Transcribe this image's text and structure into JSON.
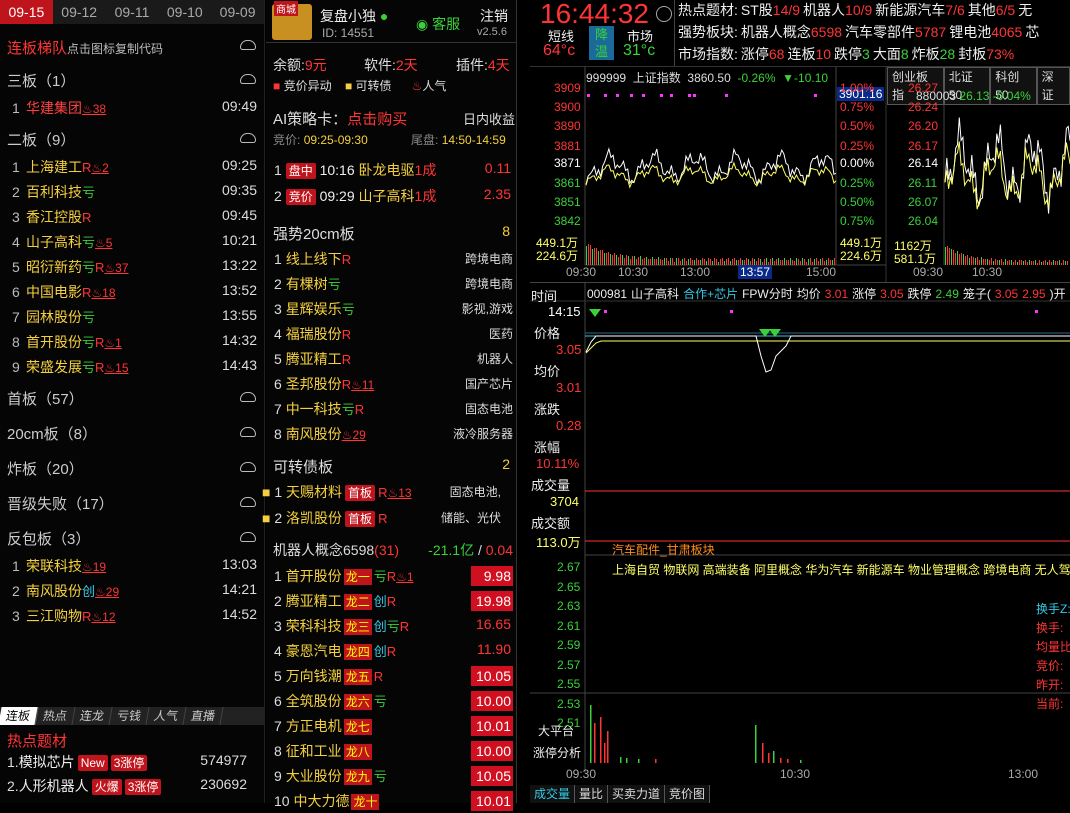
{
  "dates": [
    "09-15",
    "09-12",
    "09-11",
    "09-10",
    "09-09"
  ],
  "ladder": {
    "title": "连板梯队",
    "hint": "点击图标复制代码",
    "sections": [
      {
        "label": "三板（1）",
        "rows": [
          {
            "n": "1",
            "name": "华建集团",
            "color": "r",
            "tags": [],
            "fire": "38",
            "time": "09:49"
          }
        ]
      },
      {
        "label": "二板（9）",
        "rows": [
          {
            "n": "1",
            "name": "上海建工",
            "color": "y",
            "tags": [
              "R"
            ],
            "fire": "2",
            "time": "09:25"
          },
          {
            "n": "2",
            "name": "百利科技",
            "color": "y",
            "tags": [
              "亏"
            ],
            "fire": "",
            "time": "09:35"
          },
          {
            "n": "3",
            "name": "香江控股",
            "color": "y",
            "tags": [
              "R"
            ],
            "fire": "",
            "time": "09:45"
          },
          {
            "n": "4",
            "name": "山子高科",
            "color": "y",
            "tags": [
              "亏"
            ],
            "fire": "5",
            "time": "10:21"
          },
          {
            "n": "5",
            "name": "昭衍新药",
            "color": "y",
            "tags": [
              "亏",
              "R"
            ],
            "fire": "37",
            "time": "13:22"
          },
          {
            "n": "6",
            "name": "中国电影",
            "color": "y",
            "tags": [
              "R"
            ],
            "fire": "18",
            "time": "13:52"
          },
          {
            "n": "7",
            "name": "园林股份",
            "color": "y",
            "tags": [
              "亏"
            ],
            "fire": "",
            "time": "13:55"
          },
          {
            "n": "8",
            "name": "首开股份",
            "color": "y",
            "tags": [
              "亏",
              "R"
            ],
            "fire": "1",
            "time": "14:32"
          },
          {
            "n": "9",
            "name": "荣盛发展",
            "color": "y",
            "tags": [
              "亏",
              "R"
            ],
            "fire": "15",
            "time": "14:43"
          }
        ]
      },
      {
        "label": "首板（57）",
        "rows": []
      },
      {
        "label": "20cm板（8）",
        "rows": []
      },
      {
        "label": "炸板（20）",
        "rows": []
      },
      {
        "label": "晋级失败（17）",
        "rows": []
      },
      {
        "label": "反包板（3）",
        "rows": [
          {
            "n": "1",
            "name": "荣联科技",
            "color": "y",
            "tags": [],
            "fire": "19",
            "time": "13:03"
          },
          {
            "n": "2",
            "name": "南风股份",
            "color": "y",
            "tags": [
              "创"
            ],
            "fire": "29",
            "time": "14:21"
          },
          {
            "n": "3",
            "name": "三江购物",
            "color": "y",
            "tags": [
              "R"
            ],
            "fire": "12",
            "time": "14:52"
          }
        ]
      }
    ]
  },
  "bottom_tabs": [
    "连板",
    "热点",
    "连龙",
    "亏钱",
    "人气",
    "直播"
  ],
  "hot": {
    "title": "热点题材",
    "rows": [
      {
        "n": "1.",
        "name": "模拟芯片",
        "badge": "New",
        "cnt": "3涨停",
        "val": "574977"
      },
      {
        "n": "2.",
        "name": "人形机器人",
        "badge": "火爆",
        "cnt": "3涨停",
        "val": "230692"
      }
    ]
  },
  "p2": {
    "app": "复盘小独",
    "app_badge": "商城",
    "id": "ID: 14551",
    "service": "客服",
    "logout": "注销",
    "version": "v2.5.6",
    "balance_l": "余额:",
    "balance_v": "9元",
    "soft_l": "软件:",
    "soft_v": "2天",
    "plugin_l": "插件:",
    "plugin_v": "4天",
    "legend": [
      "竞价异动",
      "可转债",
      "人气"
    ],
    "ai": {
      "label": "AI策略卡：",
      "buy": "点击购买",
      "yield": "日内收益",
      "bid_l": "竞价:",
      "bid_v": "09:25-09:30",
      "tail_l": "尾盘:",
      "tail_v": "14:50-14:59"
    },
    "ai_rows": [
      {
        "n": "1",
        "tag": "盘中",
        "time": "10:16",
        "name": "卧龙电驱",
        "b": "1成",
        "v": "0.11"
      },
      {
        "n": "2",
        "tag": "竞价",
        "time": "09:29",
        "name": "山子高科",
        "b": "1成",
        "v": "2.35"
      }
    ],
    "s20": {
      "title": "强势20cm板",
      "count": "8",
      "rows": [
        {
          "n": "1",
          "name": "线上线下",
          "tags": [
            "R"
          ],
          "fire": "",
          "cat": "跨境电商"
        },
        {
          "n": "2",
          "name": "有棵树",
          "tags": [
            "亏"
          ],
          "fire": "",
          "cat": "跨境电商"
        },
        {
          "n": "3",
          "name": "星辉娱乐",
          "tags": [
            "亏"
          ],
          "fire": "",
          "cat": "影视,游戏"
        },
        {
          "n": "4",
          "name": "福瑞股份",
          "tags": [
            "R"
          ],
          "fire": "",
          "cat": "医药"
        },
        {
          "n": "5",
          "name": "腾亚精工",
          "tags": [
            "R"
          ],
          "fire": "",
          "cat": "机器人"
        },
        {
          "n": "6",
          "name": "圣邦股份",
          "tags": [
            "R"
          ],
          "fire": "11",
          "cat": "国产芯片"
        },
        {
          "n": "7",
          "name": "中一科技",
          "tags": [
            "亏",
            "R"
          ],
          "fire": "",
          "cat": "固态电池"
        },
        {
          "n": "8",
          "name": "南风股份",
          "tags": [],
          "fire": "29",
          "cat": "液冷服务器"
        }
      ]
    },
    "cb": {
      "title": "可转债板",
      "count": "2",
      "rows": [
        {
          "n": "1",
          "name": "天赐材料",
          "fire": "13",
          "cat": "固态电池,"
        },
        {
          "n": "2",
          "name": "洛凯股份",
          "fire": "",
          "cat": "储能、光伏"
        }
      ]
    },
    "robot": {
      "title": "机器人概念",
      "code": "6598",
      "cnt": "(31)",
      "flow": "-21.1亿",
      "sep": "/",
      "ratio": "0.04",
      "rows": [
        {
          "n": "1",
          "name": "首开股份",
          "dragon": "龙一",
          "tags": [
            "亏",
            "R"
          ],
          "fire": "1",
          "v": "9.98",
          "box": true
        },
        {
          "n": "2",
          "name": "腾亚精工",
          "dragon": "龙二",
          "tags": [
            "创",
            "R"
          ],
          "fire": "",
          "v": "19.98",
          "box": true
        },
        {
          "n": "3",
          "name": "荣科科技",
          "dragon": "龙三",
          "tags": [
            "创",
            "亏",
            "R"
          ],
          "fire": "",
          "v": "16.65",
          "box": false
        },
        {
          "n": "4",
          "name": "豪恩汽电",
          "dragon": "龙四",
          "tags": [
            "创",
            "R"
          ],
          "fire": "",
          "v": "11.90",
          "box": false
        },
        {
          "n": "5",
          "name": "万向钱潮",
          "dragon": "龙五",
          "tags": [
            "R"
          ],
          "fire": "",
          "v": "10.05",
          "box": true
        },
        {
          "n": "6",
          "name": "全筑股份",
          "dragon": "龙六",
          "tags": [
            "亏"
          ],
          "fire": "",
          "v": "10.00",
          "box": true
        },
        {
          "n": "7",
          "name": "方正电机",
          "dragon": "龙七",
          "tags": [],
          "fire": "",
          "v": "10.01",
          "box": true
        },
        {
          "n": "8",
          "name": "征和工业",
          "dragon": "龙八",
          "tags": [],
          "fire": "",
          "v": "10.00",
          "box": true
        },
        {
          "n": "9",
          "name": "大业股份",
          "dragon": "龙九",
          "tags": [
            "亏"
          ],
          "fire": "",
          "v": "10.05",
          "box": true
        },
        {
          "n": "10",
          "name": "中大力德",
          "dragon": "龙十",
          "tags": [],
          "fire": "",
          "v": "10.01",
          "box": true
        }
      ]
    }
  },
  "clock": {
    "time": "16:44:32",
    "short": "短线",
    "temp": "64°c",
    "down1": "降",
    "down2": "温",
    "market": "市场",
    "mtemp": "31°c"
  },
  "info": {
    "r1": [
      [
        "热点题材:",
        "wh"
      ],
      [
        "ST股",
        "wh"
      ],
      [
        "14/9",
        "red"
      ],
      [
        "机器人",
        "wh"
      ],
      [
        "10/9",
        "red"
      ],
      [
        "新能源汽车",
        "wh"
      ],
      [
        "7/6",
        "red"
      ],
      [
        "其他",
        "wh"
      ],
      [
        "6/5",
        "red"
      ],
      [
        "无",
        "wh"
      ]
    ],
    "r2": [
      [
        "强势板块:",
        "wh"
      ],
      [
        "机器人概念",
        "wh"
      ],
      [
        "6598",
        "red"
      ],
      [
        "汽车零部件",
        "wh"
      ],
      [
        "5787",
        "red"
      ],
      [
        "锂电池",
        "wh"
      ],
      [
        "4065",
        "red"
      ],
      [
        "芯",
        "wh"
      ]
    ],
    "r3": [
      [
        "市场指数:",
        "wh"
      ],
      [
        "涨停",
        "wh"
      ],
      [
        "68",
        "red"
      ],
      [
        "连板",
        "wh"
      ],
      [
        "10",
        "red"
      ],
      [
        "跌停",
        "wh"
      ],
      [
        "3",
        "grn"
      ],
      [
        "大面",
        "wh"
      ],
      [
        "8",
        "grn"
      ],
      [
        "炸板",
        "wh"
      ],
      [
        "28",
        "grn"
      ],
      [
        "封板",
        "wh"
      ],
      [
        "73%",
        "red"
      ]
    ]
  },
  "idx": {
    "code": "999999",
    "name": "上证指数",
    "price": "3860.50",
    "pct": "-0.26%",
    "chg": "▼-10.10",
    "flag": "3901.16",
    "ylabels": [
      "3909",
      "3900",
      "3890",
      "3881",
      "3871",
      "3861",
      "3851",
      "3842"
    ],
    "pcts": [
      "1.00%",
      "0.75%",
      "0.50%",
      "0.25%",
      "0.00%",
      "0.25%",
      "0.50%",
      "0.75%"
    ],
    "vol1": "449.1万",
    "vol2": "224.6万",
    "times": [
      "09:30",
      "10:30",
      "13:00",
      "15:00"
    ],
    "cur": "13:57",
    "tabs": [
      "创业板指",
      "北证50",
      "科创50",
      "深证"
    ],
    "code2": "880003",
    "price2": "26.13",
    "pct2": "-0.04%",
    "ylabels2": [
      "26.27",
      "26.24",
      "26.20",
      "26.17",
      "26.14",
      "26.11",
      "26.07",
      "26.04"
    ],
    "vol3": "1162万",
    "vol4": "581.1万",
    "times2": [
      "09:30",
      "10:30"
    ]
  },
  "main": {
    "t_label": "时间",
    "t_val": "14:15",
    "p_label": "价格",
    "p_val": "3.05",
    "a_label": "均价",
    "a_val": "3.01",
    "c_label": "涨跌",
    "c_val": "0.28",
    "r_label": "涨幅",
    "r_val": "10.11%",
    "v_label": "成交量",
    "v_val": "3704",
    "m_label": "成交额",
    "m_val": "113.0万",
    "header": [
      [
        "000981",
        "wh"
      ],
      [
        "山子高科",
        "wh"
      ],
      [
        "合作+芯片",
        "cyn"
      ],
      [
        "FPW分时",
        "wh"
      ],
      [
        "均价",
        "wh"
      ],
      [
        "3.01",
        "red"
      ],
      [
        "涨停",
        "wh"
      ],
      [
        "3.05",
        "red"
      ],
      [
        "跌停",
        "wh"
      ],
      [
        "2.49",
        "grn"
      ],
      [
        "笼子(",
        "wh"
      ],
      [
        "3.05",
        "red"
      ],
      [
        "2.95",
        "red"
      ],
      [
        ")开",
        "wh"
      ]
    ],
    "sector": "汽车配件_甘肃板块",
    "concepts": "上海自贸 物联网 高端装备 阿里概念 华为汽车 新能源车 物业管理概念 跨境电商 无人驾",
    "yl": [
      "2.67",
      "2.65",
      "2.63",
      "2.61",
      "2.59",
      "2.57",
      "2.55",
      "2.53",
      "2.51"
    ],
    "side": [
      [
        "换手Z:",
        "cyn"
      ],
      [
        "换手:",
        "red"
      ],
      [
        "均量比",
        "red"
      ],
      [
        "竞价:",
        "red"
      ],
      [
        "昨开:",
        "red"
      ],
      [
        "当前:",
        "red"
      ]
    ],
    "btn1": "大平台",
    "btn2": "涨停分析",
    "times": [
      "09:30",
      "10:30",
      "13:00"
    ],
    "btabs": [
      "成交量",
      "量比",
      "买卖力道",
      "竞价图"
    ]
  }
}
